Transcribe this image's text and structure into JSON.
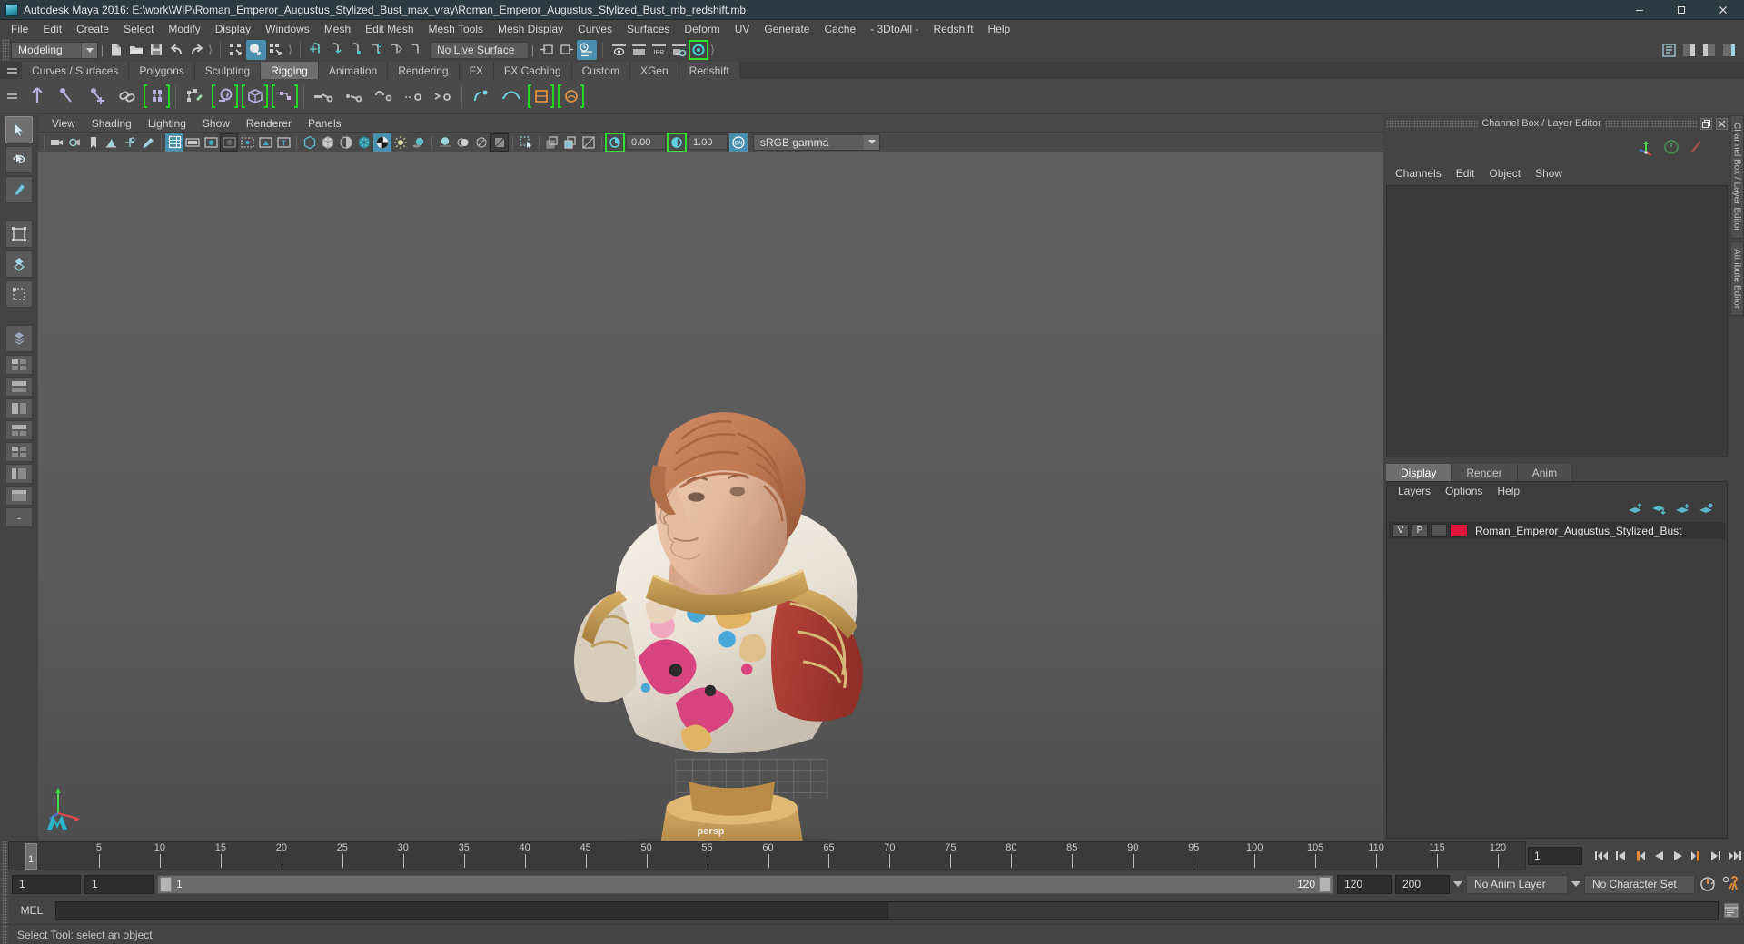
{
  "window": {
    "title": "Autodesk Maya 2016: E:\\work\\WIP\\Roman_Emperor_Augustus_Stylized_Bust_max_vray\\Roman_Emperor_Augustus_Stylized_Bust_mb_redshift.mb",
    "minimize": "–",
    "maximize": "❐",
    "close": "✕"
  },
  "menubar": {
    "items": [
      "File",
      "Edit",
      "Create",
      "Select",
      "Modify",
      "Display",
      "Windows",
      "Mesh",
      "Edit Mesh",
      "Mesh Tools",
      "Mesh Display",
      "Curves",
      "Surfaces",
      "Deform",
      "UV",
      "Generate",
      "Cache",
      "- 3DtoAll -",
      "Redshift",
      "Help"
    ]
  },
  "statusbar": {
    "menuset": "Modeling",
    "live_surface": "No Live Surface"
  },
  "shelf": {
    "tabs": [
      "Curves / Surfaces",
      "Polygons",
      "Sculpting",
      "Rigging",
      "Animation",
      "Rendering",
      "FX",
      "FX Caching",
      "Custom",
      "XGen",
      "Redshift"
    ],
    "active_tab": "Rigging"
  },
  "viewport": {
    "menus": [
      "View",
      "Shading",
      "Lighting",
      "Show",
      "Renderer",
      "Panels"
    ],
    "exposure": "0.00",
    "gamma": "1.00",
    "color_management": "sRGB gamma",
    "camera_label": "persp"
  },
  "channelbox": {
    "panel_title": "Channel Box / Layer Editor",
    "menus": [
      "Channels",
      "Edit",
      "Object",
      "Show"
    ]
  },
  "layereditor": {
    "tabs": [
      "Display",
      "Render",
      "Anim"
    ],
    "active_tab": "Display",
    "menus": [
      "Layers",
      "Options",
      "Help"
    ],
    "layers": [
      {
        "visibility": "V",
        "playback": "P",
        "shading": "",
        "color": "#e0143c",
        "name": "Roman_Emperor_Augustus_Stylized_Bust"
      }
    ]
  },
  "sidetabs": [
    "Channel Box / Layer Editor",
    "Attribute Editor"
  ],
  "timeline": {
    "tick_labels": [
      "5",
      "10",
      "15",
      "20",
      "25",
      "30",
      "35",
      "40",
      "45",
      "50",
      "55",
      "60",
      "65",
      "70",
      "75",
      "80",
      "85",
      "90",
      "95",
      "100",
      "105",
      "110",
      "115",
      "120"
    ],
    "current_frame": "1",
    "end_label": "120",
    "frame_field": "1"
  },
  "range": {
    "start": "1",
    "anim_start": "1",
    "bar_start_label": "1",
    "bar_end_label": "120",
    "anim_end": "120",
    "end": "200",
    "anim_layer": "No Anim Layer",
    "character_set": "No Character Set"
  },
  "command": {
    "language": "MEL",
    "input_value": ""
  },
  "status": {
    "message": "Select Tool: select an object"
  }
}
